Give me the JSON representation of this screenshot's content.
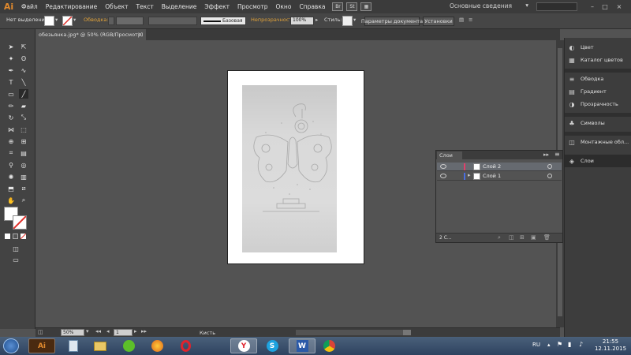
{
  "app": {
    "logo": "Ai"
  },
  "menu": [
    "Файл",
    "Редактирование",
    "Объект",
    "Текст",
    "Выделение",
    "Эффект",
    "Просмотр",
    "Окно",
    "Справка"
  ],
  "menubar_icons": [
    "Br",
    "St"
  ],
  "workspace": "Основные сведения",
  "control_bar": {
    "selection": "Нет выделения",
    "stroke_label": "Обводка:",
    "brush_label": "Базовая",
    "opacity_label": "Непрозрачность:",
    "opacity_value": "100%",
    "styles_label": "Стиль:",
    "doc_settings_button": "Параметры документа",
    "prefs_button": "Установки"
  },
  "document_tab": {
    "title": "обезьянка.jpg* @ 50% (RGB/Просмотр)",
    "close": "×"
  },
  "status_bar": {
    "zoom": "50%",
    "artboard": "1",
    "tool": "Кисть"
  },
  "dock": {
    "items": [
      {
        "label": "Цвет",
        "icon": "color-icon"
      },
      {
        "label": "Каталог цветов",
        "icon": "swatches-icon"
      },
      {
        "label": "Обводка",
        "icon": "stroke-icon"
      },
      {
        "label": "Градиент",
        "icon": "gradient-icon"
      },
      {
        "label": "Прозрачность",
        "icon": "transparency-icon"
      },
      {
        "label": "Символы",
        "icon": "symbols-icon"
      },
      {
        "label": "Монтажные обл...",
        "icon": "artboards-icon"
      },
      {
        "label": "Слои",
        "icon": "layers-icon"
      }
    ]
  },
  "layers_panel": {
    "title": "Слои",
    "layers": [
      {
        "name": "Слой 2",
        "color": "#e0406a",
        "selected": true
      },
      {
        "name": "Слой 1",
        "color": "#4a6ee0",
        "selected": false
      }
    ],
    "count": "2 С..."
  },
  "taskbar": {
    "apps": [
      "Ai",
      "Блокнот",
      "Проводник",
      "Utorrent",
      "Firefox",
      "Opera",
      "Yandex",
      "Skype",
      "Word",
      "Chrome"
    ],
    "lang": "RU",
    "time": "21:55",
    "date": "12.11.2015"
  },
  "colors": {
    "accent": "#e0892d",
    "panel": "#3d3d3d",
    "canvas": "#535353"
  }
}
